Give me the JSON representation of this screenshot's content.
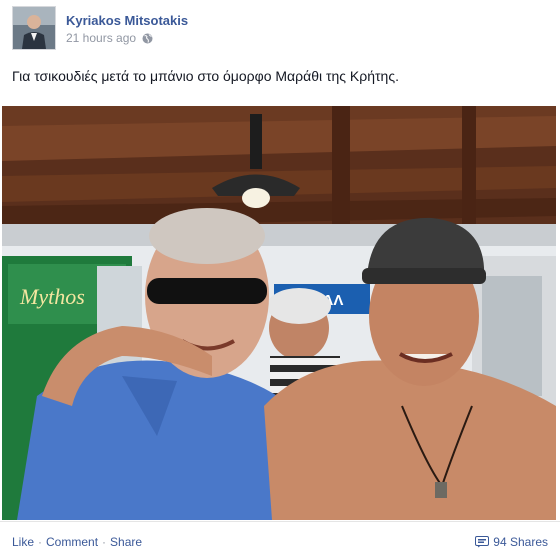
{
  "post": {
    "author": "Kyriakos Mitsotakis",
    "timestamp": "21 hours ago",
    "privacy_icon": "globe-icon",
    "status_text": "Για τσικουδιές μετά το μπάνιο στο όμορφο Μαράθι της Κρήτης.",
    "photo_signs": {
      "mythos": "Mythos",
      "fage": "ΦΕΒΓΑΛ"
    }
  },
  "actions": {
    "like": "Like",
    "comment": "Comment",
    "share": "Share",
    "separator": "·",
    "shares_count": "94 Shares",
    "shares_icon": "share-icon"
  },
  "colors": {
    "link": "#3b5998",
    "meta": "#9197a3",
    "text": "#141823"
  }
}
